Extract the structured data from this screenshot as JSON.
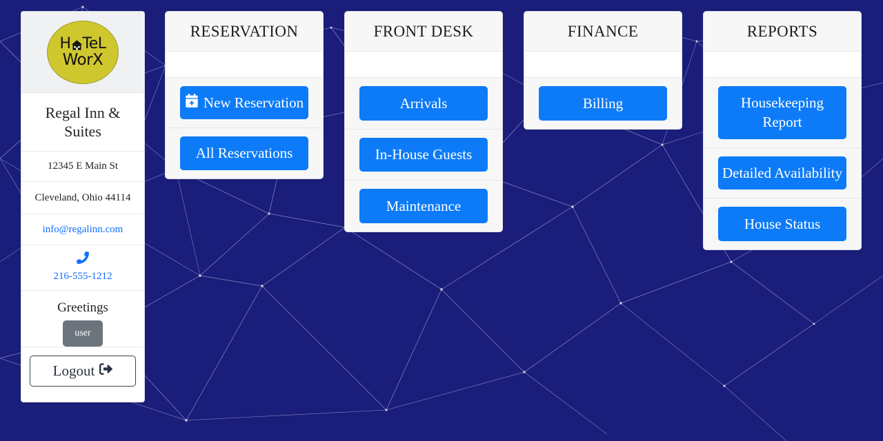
{
  "theme": {
    "background": "#1a1d7a",
    "accent_blue": "#0d7bf7",
    "link_blue": "#0d6efd",
    "logo_yellow": "#cfc72e",
    "badge_gray": "#6c757d",
    "card_bg": "#f7f7f7"
  },
  "sidebar": {
    "logo": {
      "icon": "hotel-house-icon",
      "line1_before": "H",
      "line1_after": "TeL",
      "line2": "WorX",
      "alt": "HoTeL WorX"
    },
    "hotel_name": "Regal Inn & Suites",
    "address_line": "12345 E Main St",
    "city_line": "Cleveland, Ohio 44114",
    "email": "info@regalinn.com",
    "phone_icon": "phone-icon",
    "phone": "216-555-1212",
    "greeting_label": "Greetings",
    "user_badge": "user",
    "logout_label": "Logout",
    "logout_icon": "sign-out-icon"
  },
  "cards": [
    {
      "id": "reservation",
      "title": "RESERVATION",
      "buttons": [
        {
          "label": "New Reservation",
          "icon": "calendar-plus-icon",
          "two_line": true
        },
        {
          "label": "All Reservations",
          "icon": null,
          "two_line": true
        }
      ]
    },
    {
      "id": "frontdesk",
      "title": "FRONT DESK",
      "buttons": [
        {
          "label": "Arrivals",
          "icon": null,
          "two_line": false
        },
        {
          "label": "In-House Guests",
          "icon": null,
          "two_line": true
        },
        {
          "label": "Maintenance",
          "icon": null,
          "two_line": false
        }
      ]
    },
    {
      "id": "finance",
      "title": "FINANCE",
      "buttons": [
        {
          "label": "Billing",
          "icon": null,
          "two_line": false
        }
      ]
    },
    {
      "id": "reports",
      "title": "REPORTS",
      "buttons": [
        {
          "label": "Housekeeping Report",
          "icon": null,
          "two_line": true
        },
        {
          "label": "Detailed Availability",
          "icon": null,
          "two_line": true
        },
        {
          "label": "House Status",
          "icon": null,
          "two_line": false
        }
      ]
    }
  ]
}
